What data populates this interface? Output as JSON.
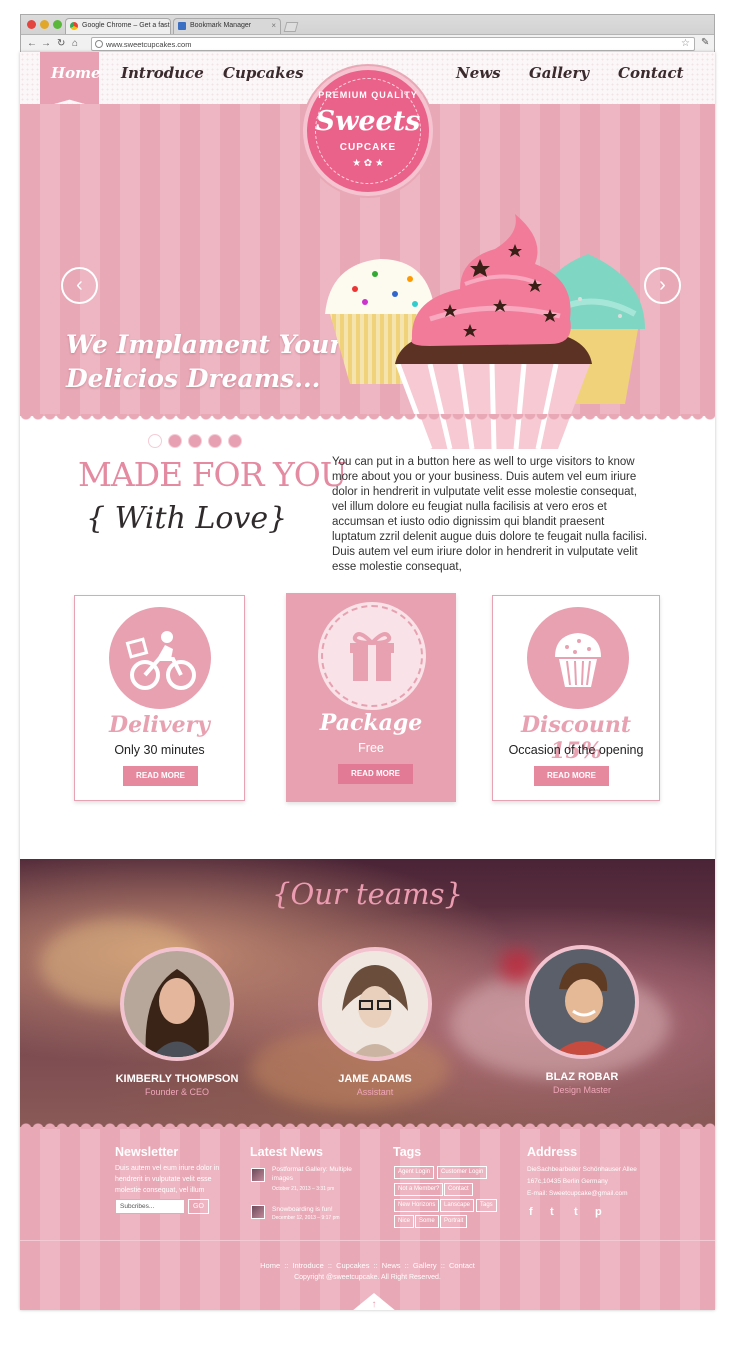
{
  "browser": {
    "tabs": [
      {
        "label": "Google Chrome – Get a fast"
      },
      {
        "label": "Bookmark Manager"
      }
    ],
    "url": "www.sweetcupcakes.com"
  },
  "nav": {
    "items": [
      "Home",
      "Introduce",
      "Cupcakes",
      "News",
      "Gallery",
      "Contact"
    ],
    "active": "Home"
  },
  "badge": {
    "top": "PREMIUM QUALITY",
    "main": "Sweets",
    "sub": "CUPCAKE"
  },
  "hero": {
    "line1": "We Implament Your",
    "line2": "Delicios Dreams...",
    "slides": 5,
    "active_slide": 1
  },
  "intro": {
    "heading": "MADE FOR YOU",
    "subheading": "{ With Love}",
    "body": "You can put in a button here as well to urge visitors to know more about you or your business. Duis autem vel eum iriure dolor in hendrerit in vulputate velit esse molestie consequat, vel illum dolore eu feugiat nulla facilisis at vero eros et accumsan et iusto odio dignissim qui blandit praesent luptatum zzril delenit augue duis dolore te feugait nulla facilisi. Duis autem vel eum iriure dolor in hendrerit in vulputate velit esse molestie consequat,"
  },
  "cards": [
    {
      "title": "Delivery",
      "subtitle": "Only 30 minutes",
      "button": "READ MORE",
      "icon": "motorbike-delivery-icon"
    },
    {
      "title": "Package",
      "subtitle": "Free",
      "button": "READ MORE",
      "icon": "gift-box-icon"
    },
    {
      "title": "Discount 15%",
      "subtitle": "Occasion of the opening",
      "button": "READ MORE",
      "icon": "cupcake-icon"
    }
  ],
  "teams": {
    "title": "{Our teams}",
    "members": [
      {
        "name": "KIMBERLY THOMPSON",
        "role": "Founder & CEO"
      },
      {
        "name": "JAME ADAMS",
        "role": "Assistant"
      },
      {
        "name": "BLAZ ROBAR",
        "role": "Design Master"
      }
    ]
  },
  "footer": {
    "newsletter": {
      "heading": "Newsletter",
      "text": "Duis autem vel eum iriure dolor in hendrerit in vulputate velit esse molestie consequat, vel illum",
      "placeholder": "Subcribes...",
      "button": "GO"
    },
    "news": {
      "heading": "Latest News",
      "items": [
        {
          "title": "Postformat Gallery: Multiple images",
          "date": "October 21, 2013 – 3:31 pm"
        },
        {
          "title": "Snowboarding is fun!",
          "date": "December 12, 2013 – 9:17 pm"
        }
      ]
    },
    "tags": {
      "heading": "Tags",
      "items": [
        "Agent Login",
        "Customer Login",
        "Not a Member?",
        "Contact",
        "New Horizons",
        "Lanscape",
        "Tags",
        "Nice",
        "Some",
        "Portrait"
      ]
    },
    "address": {
      "heading": "Address",
      "line1": "DieSachbearbeiter Schönhauser Allee",
      "line2": "167c,10435 Berlin Germany",
      "line3": "E-mail: Sweetcupcake@gmail.com",
      "social": [
        "f",
        "t",
        "t",
        "p"
      ]
    },
    "links": [
      "Home",
      "Introduce",
      "Cupcakes",
      "News",
      "Gallery",
      "Contact"
    ],
    "copyright": "Copyright @sweetcupcake. All Right Reserved."
  },
  "colors": {
    "pink": "#e8a1b1",
    "hot_pink": "#ea6289",
    "text_dark": "#2f2a2b"
  }
}
